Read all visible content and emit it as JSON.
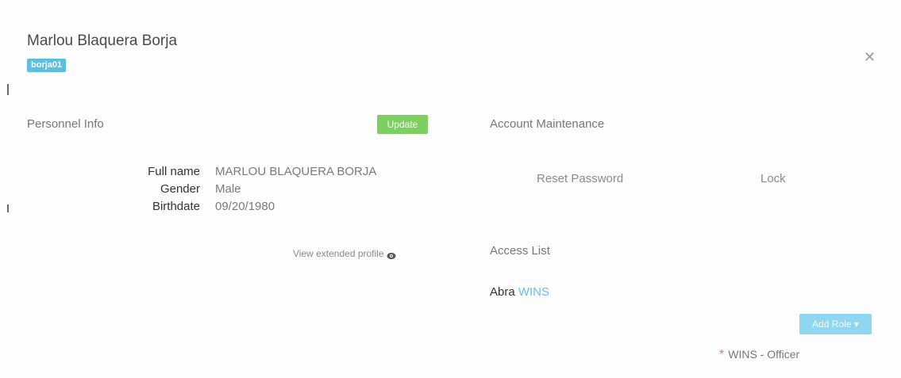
{
  "header": {
    "title": "Marlou Blaquera Borja",
    "username_badge": "borja01"
  },
  "personnel_info": {
    "section_title": "Personnel Info",
    "update_label": "Update",
    "fields": [
      {
        "label": "Full name",
        "value": "MARLOU BLAQUERA BORJA"
      },
      {
        "label": "Gender",
        "value": "Male"
      },
      {
        "label": "Birthdate",
        "value": "09/20/1980"
      }
    ],
    "extended_profile_link": "View extended profile"
  },
  "account_maintenance": {
    "section_title": "Account Maintenance",
    "reset_password_label": "Reset Password",
    "lock_label": "Lock"
  },
  "access_list": {
    "section_title": "Access List",
    "group": {
      "name_strong": "Abra",
      "name_accent": "WINS"
    },
    "add_role_label": "Add Role",
    "add_role_caret": "▾",
    "roles": [
      {
        "required_mark": "*",
        "label": "WINS - Officer"
      }
    ]
  },
  "icons": {
    "close": "close-icon",
    "eye": "eye-icon",
    "caret": "caret-down-icon"
  },
  "colors": {
    "badge": "#5bc0de",
    "update_button": "#7ecf62",
    "add_role_button": "#8fd6f0",
    "required_star": "#e57373",
    "group_accent": "#6bbde6"
  }
}
